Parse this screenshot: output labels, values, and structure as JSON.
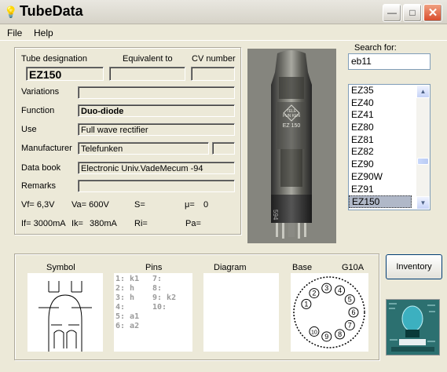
{
  "window": {
    "title": "TubeData",
    "icon": "lightbulb-icon"
  },
  "menu": {
    "file": "File",
    "help": "Help"
  },
  "labels": {
    "tube_designation": "Tube designation",
    "equivalent_to": "Equivalent to",
    "cv_number": "CV number",
    "variations": "Variations",
    "function": "Function",
    "use": "Use",
    "manufacturer": "Manufacturer",
    "data_book": "Data book",
    "remarks": "Remarks"
  },
  "values": {
    "tube_designation": "EZ150",
    "equivalent_to": "",
    "cv_number": "",
    "variations": "",
    "function": "Duo-diode",
    "use": "Full wave rectifier",
    "manufacturer": "Telefunken",
    "manufacturer_extra": "",
    "data_book": "Electronic Univ.VadeMecum -94",
    "remarks": ""
  },
  "params": {
    "vf": "Vf= 6,3V",
    "va": "Va= 600V",
    "s": "S=",
    "mu": "μ=",
    "mu_val": "0",
    "if": "If= 3000mA",
    "ik": "Ik=",
    "ik_val": "380mA",
    "ri": "Ri=",
    "pa": "Pa="
  },
  "search": {
    "label": "Search for:",
    "value": "eb11"
  },
  "tube_list": {
    "items": [
      "EZ35",
      "EZ40",
      "EZ41",
      "EZ80",
      "EZ81",
      "EZ82",
      "EZ90",
      "EZ90W",
      "EZ91",
      "EZ150"
    ],
    "selected": "EZ150"
  },
  "bottom": {
    "symbol": "Symbol",
    "pins": "Pins",
    "diagram": "Diagram",
    "base": "Base",
    "base_type": "G10A",
    "pins_left": [
      "1: k1",
      "2: h",
      "3: h",
      "4:",
      "5: a1",
      "6: a2"
    ],
    "pins_right": [
      "7:",
      "8:",
      "9: k2",
      "10:"
    ],
    "base_pin_numbers": [
      "1",
      "2",
      "3",
      "4",
      "5",
      "6",
      "7",
      "8",
      "9",
      "10"
    ]
  },
  "buttons": {
    "inventory": "Inventory"
  },
  "photo_labels": {
    "brand": "TELE FUN KEN",
    "type": "EZ 150",
    "code": "594"
  }
}
